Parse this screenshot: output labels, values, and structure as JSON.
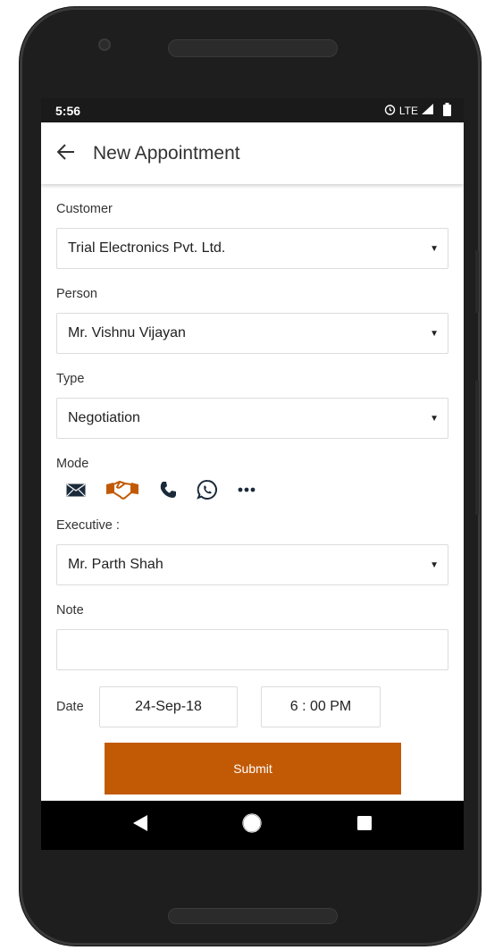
{
  "status": {
    "time": "5:56",
    "network": "LTE"
  },
  "appbar": {
    "back_icon": "arrow-left-icon",
    "title": "New Appointment"
  },
  "form": {
    "customer": {
      "label": "Customer",
      "value": "Trial Electronics Pvt. Ltd."
    },
    "person": {
      "label": "Person",
      "value": "Mr. Vishnu Vijayan"
    },
    "type": {
      "label": "Type",
      "value": "Negotiation"
    },
    "mode": {
      "label": "Mode",
      "options": [
        "email-icon",
        "handshake-icon",
        "phone-icon",
        "whatsapp-icon",
        "more-icon"
      ],
      "selected": "handshake-icon"
    },
    "executive": {
      "label": "Executive :",
      "value": "Mr. Parth Shah"
    },
    "note": {
      "label": "Note",
      "value": ""
    },
    "date": {
      "label": "Date",
      "value": "24-Sep-18",
      "time": "6 : 00 PM"
    },
    "submit_label": "Submit"
  },
  "colors": {
    "accent": "#c25a05",
    "text": "#222222",
    "border": "#dcdcdc"
  }
}
